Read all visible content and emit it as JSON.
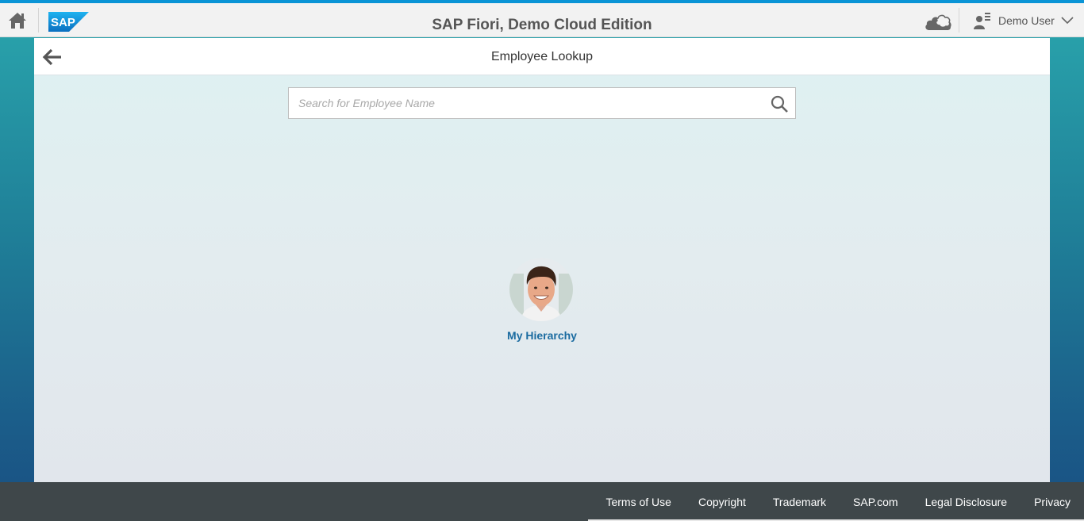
{
  "shell": {
    "title": "SAP Fiori, Demo Cloud Edition",
    "logo_text": "SAP",
    "user_name": "Demo User",
    "icons": [
      "home-icon",
      "cloud-icon",
      "user-icon",
      "chevron-down-icon"
    ]
  },
  "page": {
    "title": "Employee Lookup",
    "back_icon": "arrow-left-icon"
  },
  "search": {
    "placeholder": "Search for Employee Name",
    "value": "",
    "icon": "search-icon"
  },
  "hierarchy": {
    "label": "My Hierarchy"
  },
  "footer": {
    "links": [
      "Terms of Use",
      "Copyright",
      "Trademark",
      "SAP.com",
      "Legal Disclosure",
      "Privacy"
    ]
  },
  "colors": {
    "accent": "#0a94d6",
    "link": "#1a6ba0",
    "footer_bg": "#3f474a",
    "shell_bg": "#f2f2f2"
  }
}
